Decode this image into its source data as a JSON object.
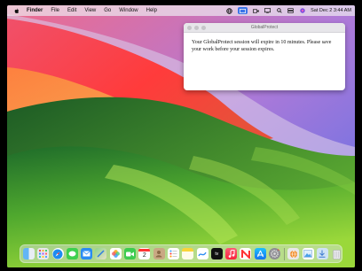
{
  "menubar": {
    "items": [
      "Finder",
      "File",
      "Edit",
      "View",
      "Go",
      "Window",
      "Help"
    ],
    "clock": "Sat Dec 2  3:44 AM"
  },
  "dialog": {
    "title": "GlobalProtect",
    "message": "Your GlobalProtect session will expire in 10 minutes. Please save your work before your session expires."
  },
  "dock": {
    "calendar_day": "2",
    "icons": [
      "finder",
      "launchpad",
      "safari",
      "messages",
      "mail",
      "maps",
      "photos",
      "facetime",
      "calendar",
      "contacts",
      "reminders",
      "notes",
      "freeform",
      "apple-tv",
      "music",
      "news",
      "app-store",
      "system-settings",
      "globalprotect",
      "preview",
      "downloads",
      "trash"
    ]
  }
}
